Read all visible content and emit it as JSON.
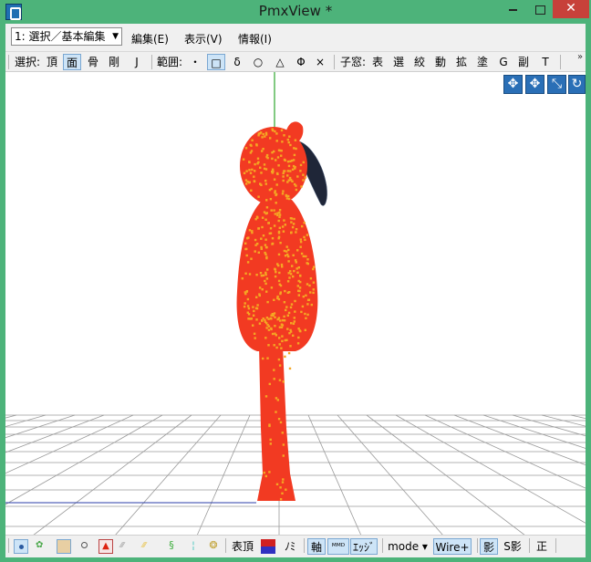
{
  "window": {
    "title": "PmxView *"
  },
  "menubar": {
    "mode_select": "1: 選択／基本編集",
    "items": [
      "編集(E)",
      "表示(V)",
      "情報(I)"
    ]
  },
  "toolbar1": {
    "select_label": "選択:",
    "select_items": [
      "頂",
      "面",
      "骨",
      "剛",
      "J"
    ],
    "range_label": "範囲:",
    "range_items": [
      "・",
      "□",
      "δ",
      "○",
      "△",
      "Φ",
      "×"
    ],
    "child_label": "子窓:",
    "child_items": [
      "表",
      "選",
      "絞",
      "動",
      "拡",
      "塗",
      "G",
      "副",
      "T"
    ],
    "overflow": "»"
  },
  "viewport": {
    "nav_buttons": [
      "move-xy-icon",
      "move-xz-icon",
      "zoom-icon",
      "rotate-icon"
    ],
    "colors": {
      "background": "#ffffff",
      "grid": "#9a9a9a",
      "figure": "#f23a22",
      "vertex": "#f5a623",
      "hair": "#1f2638",
      "axis_green": "#3fae3f",
      "axis_blue": "#2b3ea8"
    }
  },
  "toolbar2": {
    "icons": [
      "vertex-dot-icon",
      "wire-green-icon",
      "wire-mesh-icon",
      "point-icon",
      "triangle-red-icon",
      "bone-icon",
      "bone-yellow-icon",
      "figure-green-icon",
      "figure-cyan-icon",
      "material-icon"
    ],
    "vertex_label": "表頂",
    "brush_label": "ﾉﾐ",
    "axis_label": "軸",
    "mmd_label": "ᴹᴹᴰ",
    "edge_label": "ｴｯｼﾞ",
    "mode_label": "mode ▾",
    "wire_label": "Wire+",
    "shadow_label": "影",
    "sshadow_label": "S影",
    "front_label": "正"
  }
}
